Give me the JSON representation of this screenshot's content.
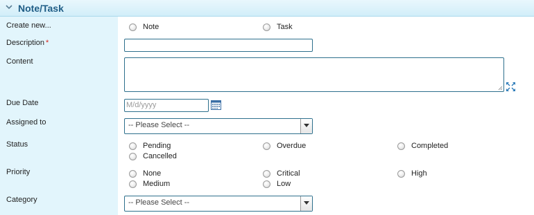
{
  "section": {
    "title": "Note/Task",
    "collapse_icon": "chevron-down-icon"
  },
  "create_new": {
    "label": "Create new...",
    "options": [
      "Note",
      "Task"
    ]
  },
  "description": {
    "label": "Description",
    "required_mark": "*",
    "value": ""
  },
  "content": {
    "label": "Content",
    "value": "",
    "expand_icon": "expand-icon"
  },
  "due_date": {
    "label": "Due Date",
    "placeholder": "M/d/yyyy",
    "calendar_icon": "calendar-icon"
  },
  "assigned_to": {
    "label": "Assigned to",
    "selected": "-- Please Select --"
  },
  "status": {
    "label": "Status",
    "options": [
      "Pending",
      "Overdue",
      "Completed",
      "Cancelled"
    ]
  },
  "priority": {
    "label": "Priority",
    "options": [
      "None",
      "Critical",
      "High",
      "Medium",
      "Low"
    ]
  },
  "category": {
    "label": "Category",
    "selected": "-- Please Select --"
  },
  "colors": {
    "header_text": "#1f5d86",
    "label_bg": "#e2f5fc",
    "field_border": "#2d6f8c",
    "required": "#d9251d"
  }
}
